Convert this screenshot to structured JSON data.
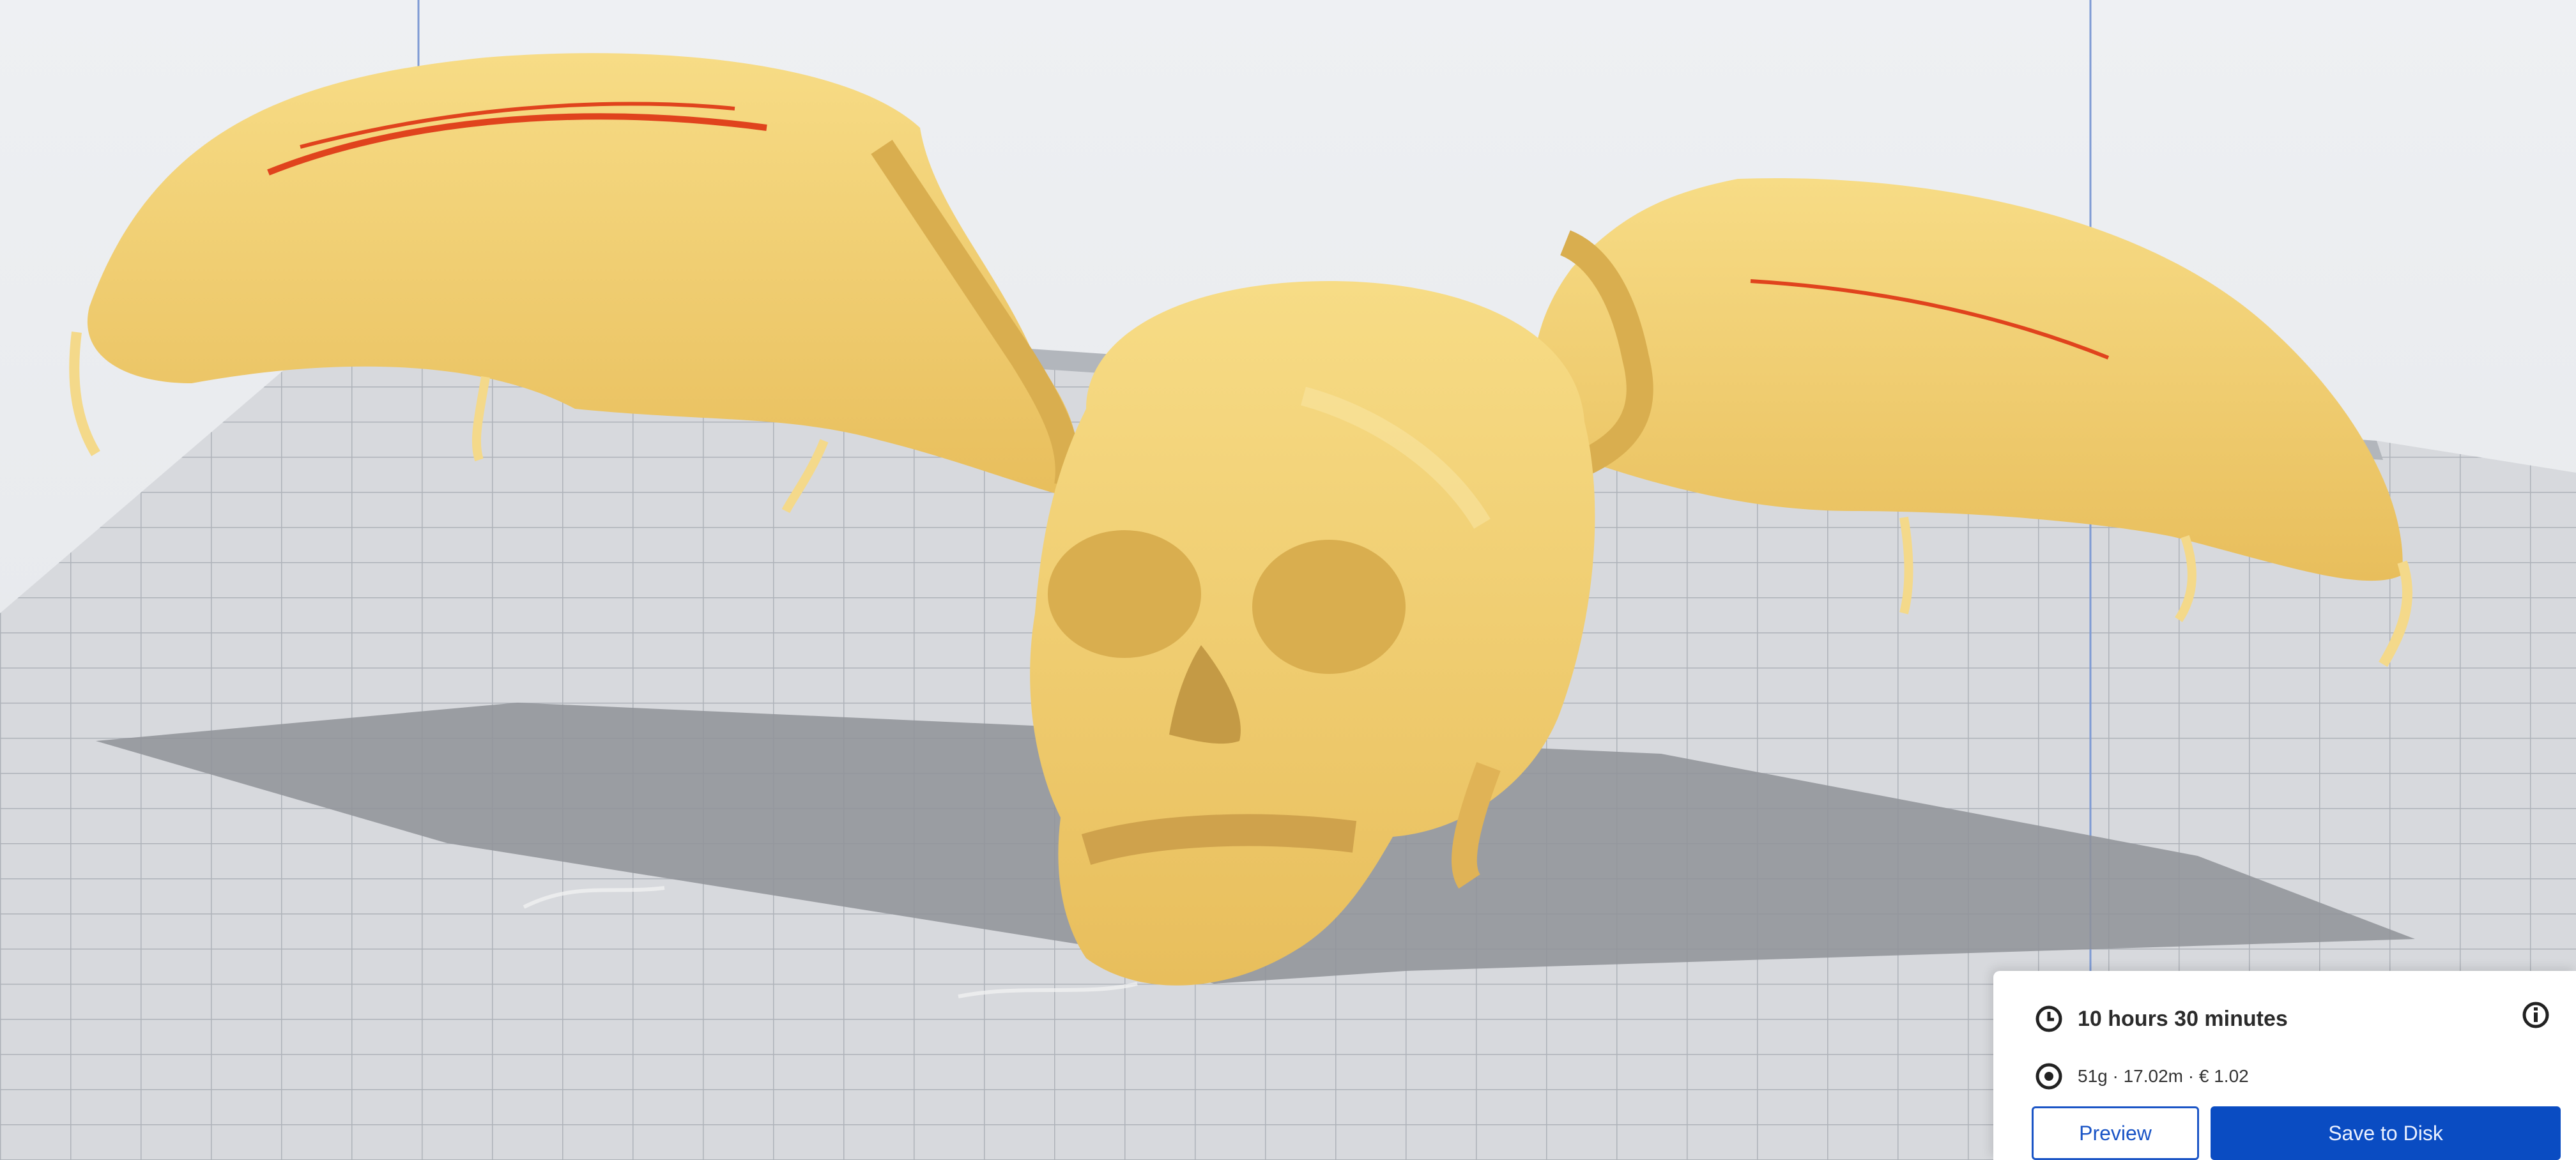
{
  "print_summary": {
    "time_label": "10 hours 30 minutes",
    "material_label": "51g · 17.02m · € 1.02",
    "clock_icon": "clock-icon",
    "spool_icon": "spool-icon",
    "info_icon": "info-icon"
  },
  "actions": {
    "preview_label": "Preview",
    "save_label": "Save to Disk"
  },
  "colors": {
    "model": "#f2cf72",
    "overhang": "#e0431d",
    "accent": "#0a4cc2",
    "build_plate": "#c9ccd1"
  }
}
